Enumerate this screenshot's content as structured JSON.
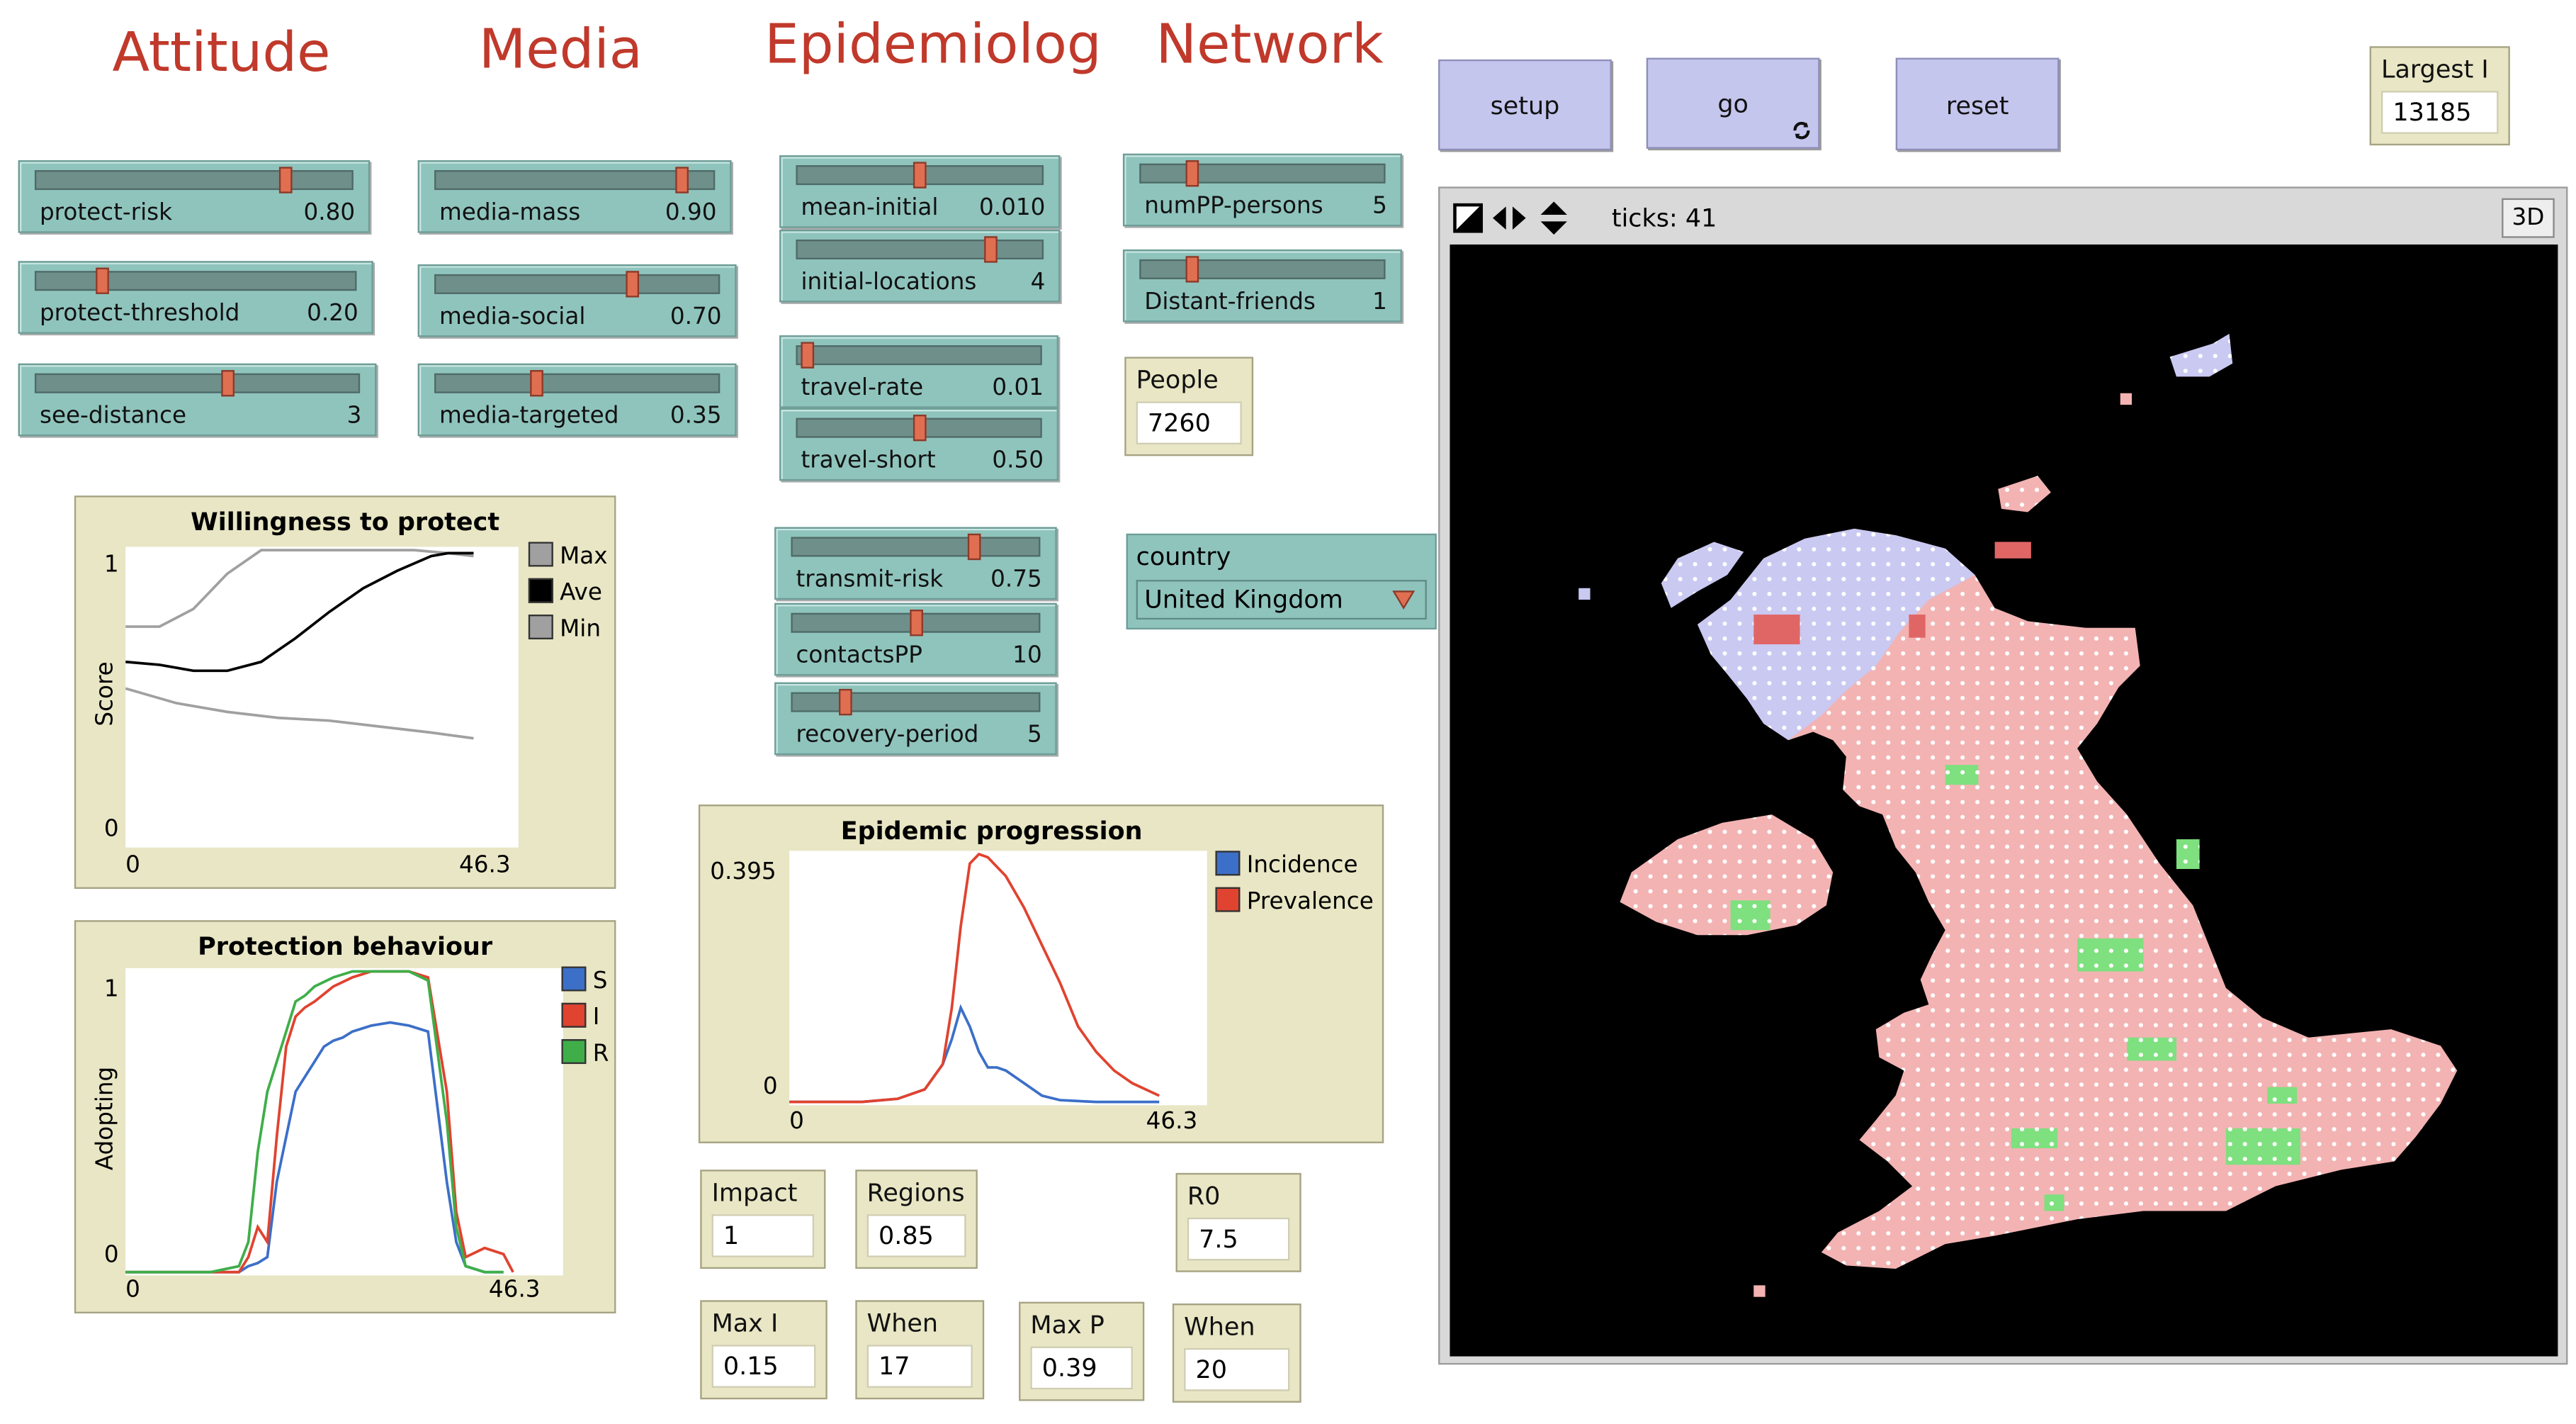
{
  "headers": {
    "attitude": "Attitude",
    "media": "Media",
    "epidemiology": "Epidemiolog",
    "network": "Network"
  },
  "sliders": [
    {
      "label": "protect-risk",
      "value": "0.80",
      "frac": 0.8
    },
    {
      "label": "protect-threshold",
      "value": "0.20",
      "frac": 0.2
    },
    {
      "label": "see-distance",
      "value": "3",
      "frac": 0.6
    },
    {
      "label": "media-mass",
      "value": "0.90",
      "frac": 0.9
    },
    {
      "label": "media-social",
      "value": "0.70",
      "frac": 0.7
    },
    {
      "label": "media-targeted",
      "value": "0.35",
      "frac": 0.35
    },
    {
      "label": "mean-initial",
      "value": "0.010",
      "frac": 0.5
    },
    {
      "label": "initial-locations",
      "value": "4",
      "frac": 0.8
    },
    {
      "label": "travel-rate",
      "value": "0.01",
      "frac": 0.02
    },
    {
      "label": "travel-short",
      "value": "0.50",
      "frac": 0.5
    },
    {
      "label": "transmit-risk",
      "value": "0.75",
      "frac": 0.75
    },
    {
      "label": "contactsPP",
      "value": "10",
      "frac": 0.5
    },
    {
      "label": "recovery-period",
      "value": "5",
      "frac": 0.2
    },
    {
      "label": "numPP-persons",
      "value": "5",
      "frac": 0.2
    },
    {
      "label": "Distant-friends",
      "value": "1",
      "frac": 0.2
    }
  ],
  "buttons": {
    "setup": "setup",
    "go": "go",
    "go_icon": "forever-icon",
    "reset": "reset"
  },
  "monitors": {
    "largest_i": {
      "label": "Largest I",
      "value": "13185"
    },
    "people": {
      "label": "People",
      "value": "7260"
    },
    "impact": {
      "label": "Impact",
      "value": "1"
    },
    "regions": {
      "label": "Regions",
      "value": "0.85"
    },
    "r0": {
      "label": "R0",
      "value": "7.5"
    },
    "max_i": {
      "label": "Max I",
      "value": "0.15"
    },
    "when_i": {
      "label": "When",
      "value": "17"
    },
    "max_p": {
      "label": "Max P",
      "value": "0.39"
    },
    "when_p": {
      "label": "When",
      "value": "20"
    }
  },
  "chooser": {
    "label": "country",
    "value": "United Kingdom"
  },
  "view": {
    "ticks": "ticks: 41",
    "three_d": "3D"
  },
  "colors": {
    "slider": "#8fc4bd",
    "button": "#c5c6ee",
    "monitor": "#e8e6c4",
    "header": "#c0392b",
    "infected": "#f3b3b3",
    "susceptible": "#c9c9f2",
    "recovered": "#7ee07e"
  },
  "chart_data": [
    {
      "type": "line",
      "title": "Willingness to protect",
      "ylabel": "Score",
      "xlabel": "",
      "x_ticks": [
        "0",
        "46.3"
      ],
      "y_ticks": [
        "0",
        "1"
      ],
      "xlim": [
        0,
        46.3
      ],
      "ylim": [
        0,
        1
      ],
      "series": [
        {
          "name": "Max",
          "color": "#a0a0a0",
          "x": [
            0,
            4,
            8,
            12,
            16,
            22,
            26,
            30,
            34,
            38,
            41
          ],
          "values": [
            0.74,
            0.74,
            0.8,
            0.92,
            1.0,
            1.0,
            1.0,
            1.0,
            1.0,
            0.99,
            0.98
          ]
        },
        {
          "name": "Ave",
          "color": "#000000",
          "x": [
            0,
            4,
            8,
            12,
            16,
            20,
            24,
            28,
            32,
            36,
            38,
            41
          ],
          "values": [
            0.62,
            0.61,
            0.59,
            0.59,
            0.62,
            0.7,
            0.79,
            0.87,
            0.93,
            0.98,
            0.99,
            0.99
          ]
        },
        {
          "name": "Min",
          "color": "#a0a0a0",
          "x": [
            0,
            6,
            12,
            18,
            24,
            30,
            36,
            41
          ],
          "values": [
            0.53,
            0.48,
            0.45,
            0.43,
            0.42,
            0.4,
            0.38,
            0.36
          ]
        }
      ]
    },
    {
      "type": "line",
      "title": "Protection behaviour",
      "ylabel": "Adopting",
      "xlabel": "",
      "x_ticks": [
        "0",
        "46.3"
      ],
      "y_ticks": [
        "0",
        "1"
      ],
      "xlim": [
        0,
        46.3
      ],
      "ylim": [
        0,
        1
      ],
      "series": [
        {
          "name": "S",
          "color": "#3c6fc8",
          "x": [
            0,
            9,
            12,
            13,
            14,
            15,
            16,
            17,
            18,
            19,
            20,
            21,
            22,
            23,
            24,
            26,
            28,
            30,
            32,
            34,
            35,
            36,
            38,
            40
          ],
          "values": [
            0,
            0,
            0,
            0.02,
            0.03,
            0.05,
            0.3,
            0.45,
            0.6,
            0.65,
            0.7,
            0.75,
            0.77,
            0.78,
            0.8,
            0.82,
            0.83,
            0.82,
            0.8,
            0.3,
            0.1,
            0.02,
            0,
            0
          ]
        },
        {
          "name": "I",
          "color": "#e0432f",
          "x": [
            0,
            9,
            12,
            13,
            14,
            15,
            16,
            17,
            18,
            19,
            20,
            22,
            24,
            26,
            28,
            30,
            32,
            34,
            35,
            36,
            38,
            40,
            41
          ],
          "values": [
            0,
            0,
            0,
            0.05,
            0.15,
            0.1,
            0.45,
            0.75,
            0.85,
            0.88,
            0.9,
            0.95,
            0.98,
            1.0,
            1.0,
            1.0,
            0.98,
            0.6,
            0.2,
            0.05,
            0.08,
            0.06,
            0
          ]
        },
        {
          "name": "R",
          "color": "#3fae49",
          "x": [
            0,
            9,
            12,
            13,
            14,
            15,
            16,
            17,
            18,
            19,
            20,
            22,
            24,
            26,
            28,
            30,
            32,
            34,
            35,
            36,
            38,
            40
          ],
          "values": [
            0,
            0,
            0.02,
            0.1,
            0.4,
            0.6,
            0.7,
            0.8,
            0.9,
            0.92,
            0.95,
            0.98,
            1.0,
            1.0,
            1.0,
            1.0,
            0.97,
            0.5,
            0.15,
            0.02,
            0,
            0
          ]
        }
      ]
    },
    {
      "type": "line",
      "title": "Epidemic progression",
      "xlabel": "",
      "ylabel": "",
      "x_ticks": [
        "0",
        "46.3"
      ],
      "y_ticks": [
        "0",
        "0.395"
      ],
      "xlim": [
        0,
        46.3
      ],
      "ylim": [
        0,
        0.395
      ],
      "series": [
        {
          "name": "Incidence",
          "color": "#3c6fc8",
          "x": [
            0,
            8,
            12,
            15,
            17,
            18,
            19,
            20,
            21,
            22,
            23,
            24,
            26,
            28,
            30,
            34,
            41
          ],
          "values": [
            0,
            0,
            0.005,
            0.02,
            0.06,
            0.1,
            0.15,
            0.12,
            0.08,
            0.055,
            0.055,
            0.05,
            0.03,
            0.01,
            0.003,
            0,
            0
          ]
        },
        {
          "name": "Prevalence",
          "color": "#e0432f",
          "x": [
            0,
            8,
            12,
            15,
            17,
            18,
            19,
            20,
            21,
            22,
            24,
            26,
            28,
            30,
            32,
            34,
            36,
            38,
            41
          ],
          "values": [
            0,
            0,
            0.005,
            0.02,
            0.06,
            0.15,
            0.28,
            0.38,
            0.395,
            0.39,
            0.36,
            0.31,
            0.25,
            0.19,
            0.12,
            0.08,
            0.05,
            0.03,
            0.01
          ]
        }
      ]
    }
  ]
}
